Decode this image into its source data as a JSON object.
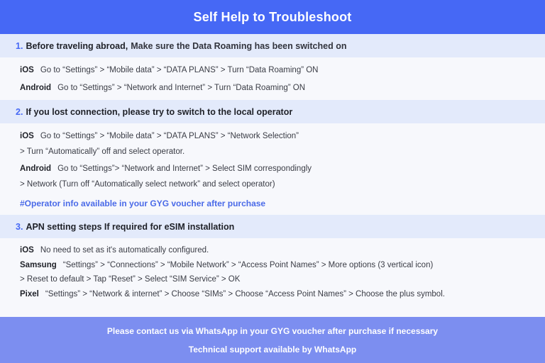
{
  "header": {
    "title": "Self Help to Troubleshoot",
    "background_color": "#4668f5",
    "text_color": "#ffffff"
  },
  "colors": {
    "accent": "#4668f5",
    "band": "#e3eafb",
    "page_background": "#f7f8fc",
    "footer_background": "#7c8ef0",
    "note_blue": "#4a6ae8"
  },
  "sections": [
    {
      "number": "1.",
      "heading_strong": "Before traveling abroad,",
      "heading_rest": "Make sure the Data Roaming has been switched on",
      "rows": [
        {
          "label": "iOS",
          "text": "Go to “Settings” > “Mobile data” > “DATA PLANS” > Turn “Data Roaming” ON"
        },
        {
          "label": "Android",
          "text": "Go to “Settings” > “Network and Internet” > Turn “Data Roaming” ON"
        }
      ],
      "note": ""
    },
    {
      "number": "2.",
      "heading_strong": "If you lost connection, please try to switch to the local operator",
      "heading_rest": "",
      "rows": [
        {
          "label": "iOS",
          "text": "Go to “Settings” > “Mobile data” > “DATA PLANS” > “Network Selection”"
        },
        {
          "label": "",
          "text": "> Turn “Automatically” off and select operator."
        },
        {
          "label": "Android",
          "text": "Go to “Settings”>  “Network and Internet” > Select SIM correspondingly"
        },
        {
          "label": "",
          "text": "> Network (Turn off “Automatically select network” and select operator)"
        }
      ],
      "note": "#Operator info available in your GYG voucher after purchase"
    },
    {
      "number": "3.",
      "heading_strong": "APN setting steps If required for eSIM installation",
      "heading_rest": "",
      "rows": [
        {
          "label": "iOS",
          "text": "No need to set as it's automatically configured."
        },
        {
          "label": "Samsung",
          "text": "“Settings” > “Connections” > “Mobile Network” > “Access Point Names” > More options (3 vertical icon)"
        },
        {
          "label": "",
          "text": "> Reset to default > Tap “Reset” > Select “SIM Service” > OK"
        },
        {
          "label": "Pixel",
          "text": "“Settings” > “Network & internet” > Choose “SIMs” > Choose “Access Point Names” > Choose the plus symbol."
        }
      ],
      "note": ""
    }
  ],
  "footer": {
    "line1": "Please contact us via WhatsApp  in your GYG voucher after purchase if necessary",
    "line2": "Technical support available by WhatsApp"
  }
}
